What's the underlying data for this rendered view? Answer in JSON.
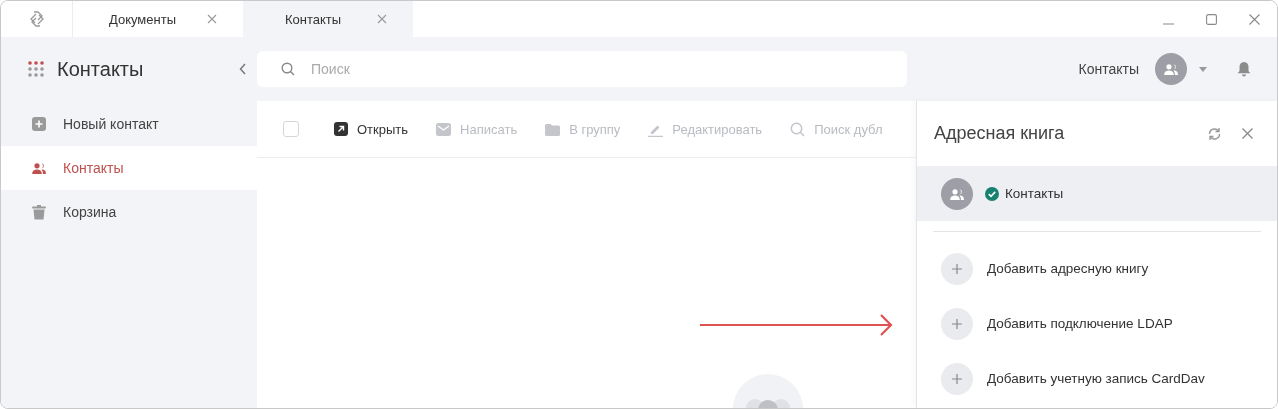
{
  "window": {
    "tabs": [
      {
        "label": "Документы",
        "selected": false
      },
      {
        "label": "Контакты",
        "selected": true
      }
    ]
  },
  "header": {
    "app_title": "Контакты",
    "search": {
      "placeholder": "Поиск"
    },
    "account_label": "Контакты"
  },
  "sidebar": {
    "items": [
      {
        "label": "Новый контакт",
        "kind": "add",
        "selected": false
      },
      {
        "label": "Контакты",
        "kind": "contacts",
        "selected": true
      },
      {
        "label": "Корзина",
        "kind": "trash",
        "selected": false
      }
    ]
  },
  "toolbar": {
    "select_all": {
      "checked": false
    },
    "actions": [
      {
        "label": "Открыть",
        "kind": "open",
        "disabled": false
      },
      {
        "label": "Написать",
        "kind": "write",
        "disabled": true
      },
      {
        "label": "В группу",
        "kind": "group",
        "disabled": true
      },
      {
        "label": "Редактировать",
        "kind": "edit",
        "disabled": true
      },
      {
        "label": "Поиск дубл",
        "kind": "search",
        "disabled": true
      }
    ]
  },
  "address_book_panel": {
    "title": "Адресная книга",
    "books": [
      {
        "label": "Контакты",
        "checked": true,
        "selected": true
      }
    ],
    "add_actions": [
      {
        "label": "Добавить адресную книгу"
      },
      {
        "label": "Добавить подключение LDAP"
      },
      {
        "label": "Добавить учетную запись CardDav"
      }
    ]
  }
}
